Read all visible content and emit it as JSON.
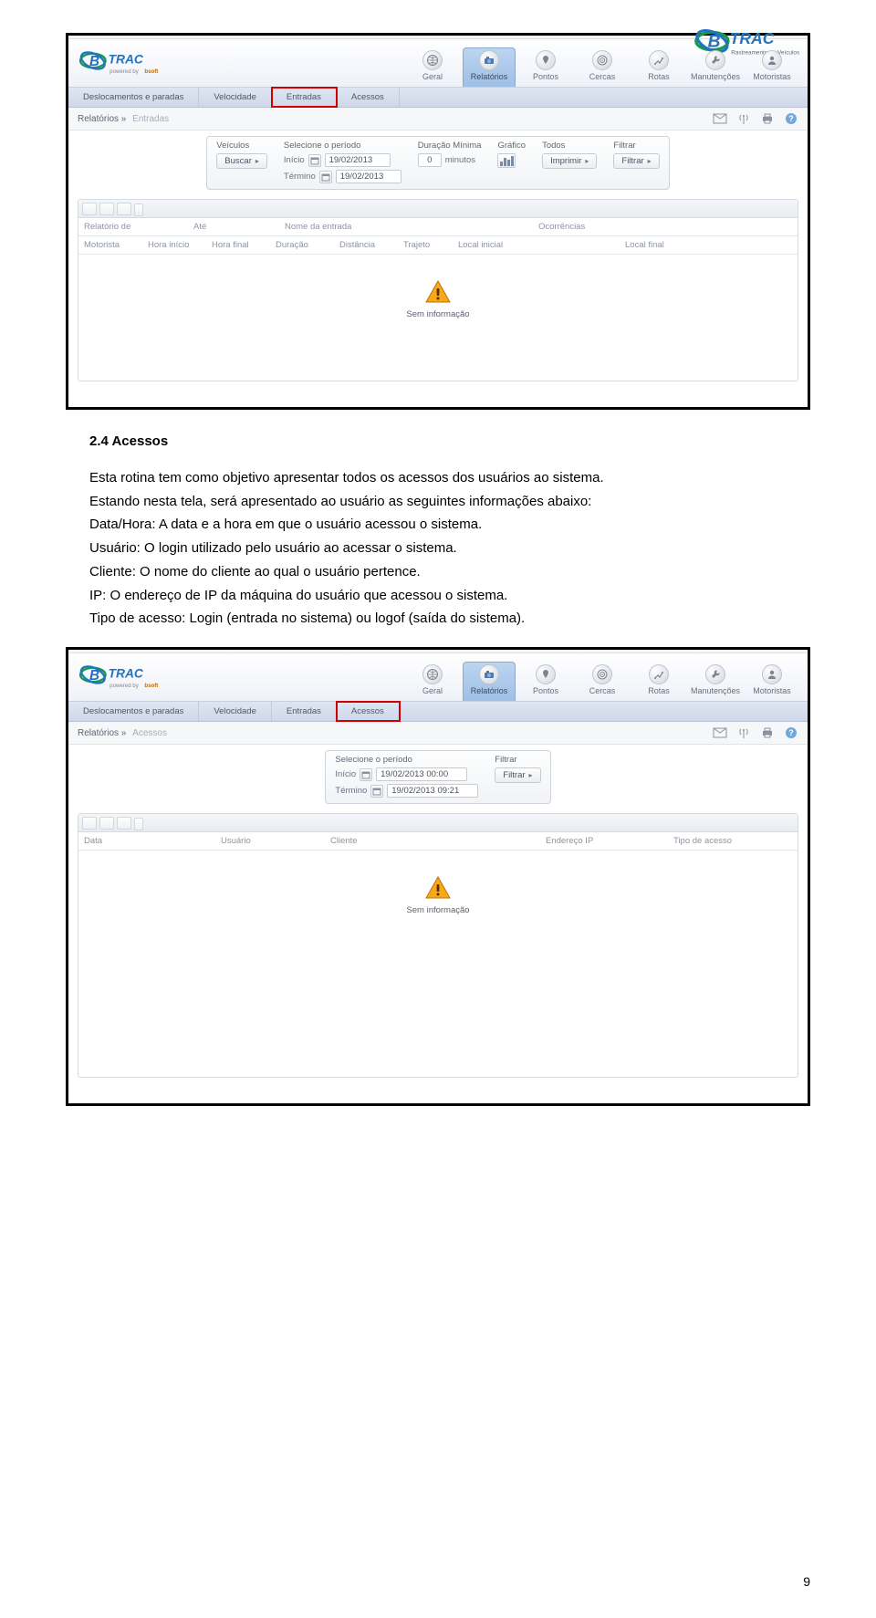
{
  "corner_logo": {
    "brand": "BTRAC",
    "tagline": "Rastreamento de Veículos"
  },
  "app": {
    "brand": "BTRAC",
    "powered": "powered by bsoft",
    "mainnav": {
      "items": [
        {
          "label": "Geral"
        },
        {
          "label": "Relatórios"
        },
        {
          "label": "Pontos"
        },
        {
          "label": "Cercas"
        },
        {
          "label": "Rotas"
        },
        {
          "label": "Manutenções"
        },
        {
          "label": "Motoristas"
        }
      ],
      "active_index": 1
    }
  },
  "shot1": {
    "subnav": [
      "Deslocamentos e paradas",
      "Velocidade",
      "Entradas",
      "Acessos"
    ],
    "subnav_highlight_index": 2,
    "breadcrumb": {
      "root": "Relatórios",
      "current": "Entradas"
    },
    "filter": {
      "veiculos_label": "Veículos",
      "buscar_label": "Buscar",
      "periodo_label": "Selecione o período",
      "inicio_label": "Início",
      "termino_label": "Término",
      "inicio_value": "19/02/2013",
      "termino_value": "19/02/2013",
      "duracao_label": "Duração Mínima",
      "duracao_value": "0",
      "duracao_unit": "minutos",
      "grafico_label": "Gráfico",
      "todos_label": "Todos",
      "imprimir_label": "Imprimir",
      "filtrar_label": "Filtrar",
      "filtrar_btn": "Filtrar"
    },
    "thead1": [
      "Relatório de",
      "Até",
      "Nome da entrada",
      "Ocorrências"
    ],
    "thead2": [
      "Motorista",
      "Hora início",
      "Hora final",
      "Duração",
      "Distância",
      "Trajeto",
      "Local inicial",
      "Local final"
    ],
    "empty": "Sem informação"
  },
  "section": {
    "heading": "2.4 Acessos",
    "p1": "Esta rotina tem como objetivo apresentar todos os acessos dos usuários ao sistema.",
    "p2": "Estando nesta tela, será apresentado ao usuário as seguintes informações abaixo:",
    "li1": "Data/Hora: A data e a hora em que o usuário acessou o sistema.",
    "li2": "Usuário: O login utilizado pelo usuário ao acessar o sistema.",
    "li3": "Cliente: O nome do cliente ao qual o usuário pertence.",
    "li4": "IP: O endereço de IP da máquina do usuário que acessou o sistema.",
    "li5": "Tipo de acesso: Login (entrada no sistema) ou logof (saída do sistema)."
  },
  "shot2": {
    "subnav": [
      "Deslocamentos e paradas",
      "Velocidade",
      "Entradas",
      "Acessos"
    ],
    "subnav_highlight_index": 3,
    "breadcrumb": {
      "root": "Relatórios",
      "current": "Acessos"
    },
    "filter": {
      "periodo_label": "Selecione o período",
      "inicio_label": "Início",
      "termino_label": "Término",
      "inicio_value": "19/02/2013 00:00",
      "termino_value": "19/02/2013 09:21",
      "filtrar_label": "Filtrar",
      "filtrar_btn": "Filtrar"
    },
    "thead": [
      "Data",
      "Usuário",
      "Cliente",
      "Endereço IP",
      "Tipo de acesso"
    ],
    "empty": "Sem informação"
  },
  "page_number": "9"
}
